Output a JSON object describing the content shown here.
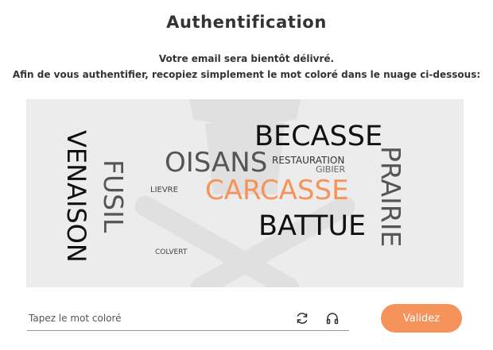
{
  "page": {
    "title": "Authentification",
    "instruction_line1": "Votre email sera bientôt délivré.",
    "instruction_line2": "Afin de vous authentifier, recopiez simplement le mot coloré dans le nuage ci-dessous:"
  },
  "captcha": {
    "words": {
      "venaison": "VENAISON",
      "fusil": "FUSIL",
      "lievre": "LIEVRE",
      "oisans": "OISANS",
      "becasse": "BECASSE",
      "restauration": "RESTAURATION",
      "gibier": "GIBIER",
      "carcasse": "CARCASSE",
      "prairie": "PRAIRIE",
      "battue": "BATTUE",
      "colvert": "COLVERT"
    },
    "highlight_color": "#f5935a"
  },
  "form": {
    "input_placeholder": "Tapez le mot coloré",
    "input_value": "",
    "refresh_icon": "refresh-icon",
    "audio_icon": "headphones-icon",
    "submit_label": "Validez"
  },
  "colors": {
    "accent": "#f5935a",
    "cloud_background": "#ececec",
    "text": "#333333"
  }
}
